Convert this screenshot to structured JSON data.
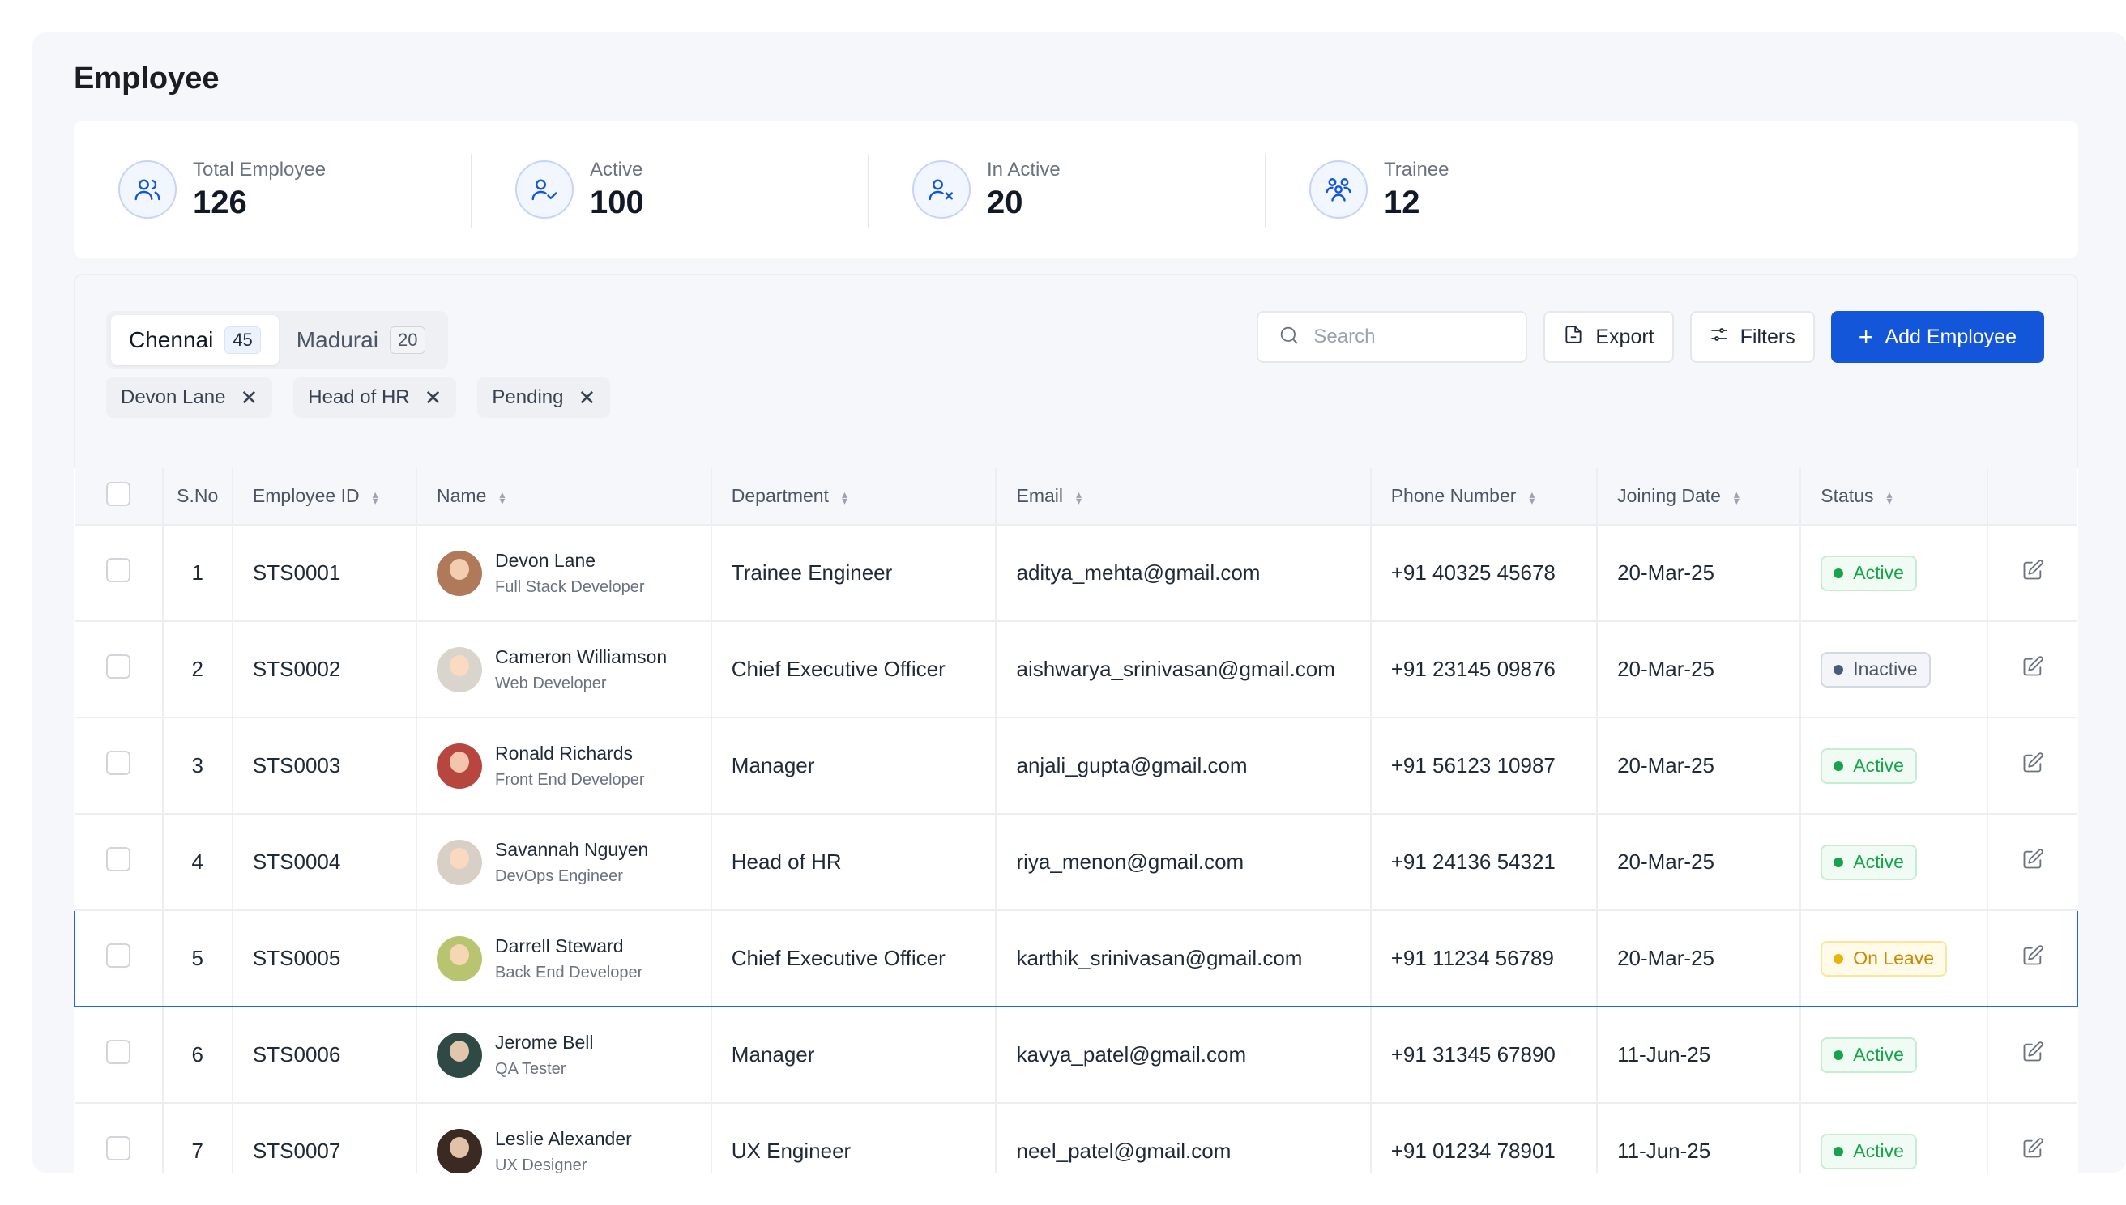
{
  "page": {
    "title": "Employee"
  },
  "stats": [
    {
      "label": "Total Employee",
      "value": "126",
      "icon": "users-icon"
    },
    {
      "label": "Active",
      "value": "100",
      "icon": "user-check-icon"
    },
    {
      "label": "In Active",
      "value": "20",
      "icon": "user-x-icon"
    },
    {
      "label": "Trainee",
      "value": "12",
      "icon": "group-icon"
    }
  ],
  "tabs": [
    {
      "label": "Chennai",
      "count": "45",
      "active": true
    },
    {
      "label": "Madurai",
      "count": "20",
      "active": false
    }
  ],
  "filters": [
    "Devon Lane",
    "Head of HR",
    "Pending"
  ],
  "toolbar": {
    "search_placeholder": "Search",
    "export_label": "Export",
    "filters_label": "Filters",
    "add_label": "Add Employee"
  },
  "table": {
    "columns": [
      "S.No",
      "Employee ID",
      "Name",
      "Department",
      "Email",
      "Phone Number",
      "Joining Date",
      "Status"
    ],
    "rows": [
      {
        "sno": "1",
        "id": "STS0001",
        "name": "Devon Lane",
        "role": "Full Stack Developer",
        "dept": "Trainee Engineer",
        "email": "aditya_mehta@gmail.com",
        "phone": "+91 40325 45678",
        "date": "20-Mar-25",
        "status": "Active",
        "avatar": "#b07a5a"
      },
      {
        "sno": "2",
        "id": "STS0002",
        "name": "Cameron Williamson",
        "role": "Web Developer",
        "dept": "Chief Executive Officer",
        "email": "aishwarya_srinivasan@gmail.com",
        "phone": "+91 23145 09876",
        "date": "20-Mar-25",
        "status": "Inactive",
        "avatar": "#d9d4cc"
      },
      {
        "sno": "3",
        "id": "STS0003",
        "name": "Ronald Richards",
        "role": "Front End Developer",
        "dept": "Manager",
        "email": "anjali_gupta@gmail.com",
        "phone": "+91 56123 10987",
        "date": "20-Mar-25",
        "status": "Active",
        "avatar": "#b6463e"
      },
      {
        "sno": "4",
        "id": "STS0004",
        "name": "Savannah Nguyen",
        "role": "DevOps Engineer",
        "dept": "Head of HR",
        "email": "riya_menon@gmail.com",
        "phone": "+91 24136 54321",
        "date": "20-Mar-25",
        "status": "Active",
        "avatar": "#d8cfc6"
      },
      {
        "sno": "5",
        "id": "STS0005",
        "name": "Darrell Steward",
        "role": "Back End Developer",
        "dept": "Chief Executive Officer",
        "email": "karthik_srinivasan@gmail.com",
        "phone": "+91 11234 56789",
        "date": "20-Mar-25",
        "status": "On Leave",
        "avatar": "#b9c470",
        "selected": true
      },
      {
        "sno": "6",
        "id": "STS0006",
        "name": "Jerome Bell",
        "role": "QA Tester",
        "dept": "Manager",
        "email": "kavya_patel@gmail.com",
        "phone": "+91 31345 67890",
        "date": "11-Jun-25",
        "status": "Active",
        "avatar": "#2f4a44"
      },
      {
        "sno": "7",
        "id": "STS0007",
        "name": "Leslie Alexander",
        "role": "UX Designer",
        "dept": "UX Engineer",
        "email": "neel_patel@gmail.com",
        "phone": "+91 01234 78901",
        "date": "11-Jun-25",
        "status": "Active",
        "avatar": "#3a2a22"
      }
    ]
  },
  "colors": {
    "accent": "#1456d9",
    "active": "#16a34a",
    "inactive": "#4b5563",
    "leave": "#ca8a04"
  }
}
